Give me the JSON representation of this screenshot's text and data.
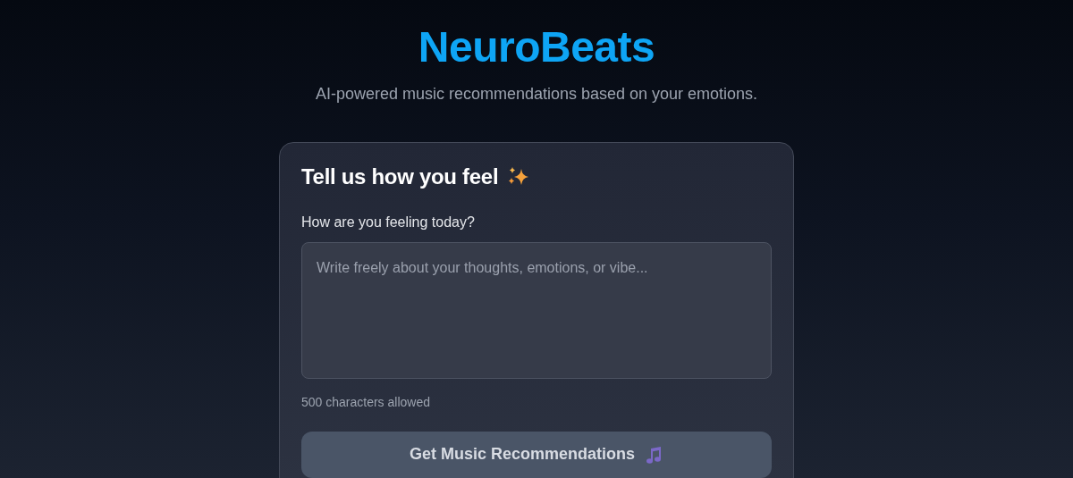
{
  "header": {
    "title": "NeuroBeats",
    "subtitle": "AI-powered music recommendations based on your emotions."
  },
  "card": {
    "heading": "Tell us how you feel",
    "field": {
      "label": "How are you feeling today?",
      "placeholder": "Write freely about your thoughts, emotions, or vibe..."
    },
    "helper": "500 characters allowed",
    "button": {
      "label": "Get Music Recommendations",
      "disabled": true
    }
  }
}
